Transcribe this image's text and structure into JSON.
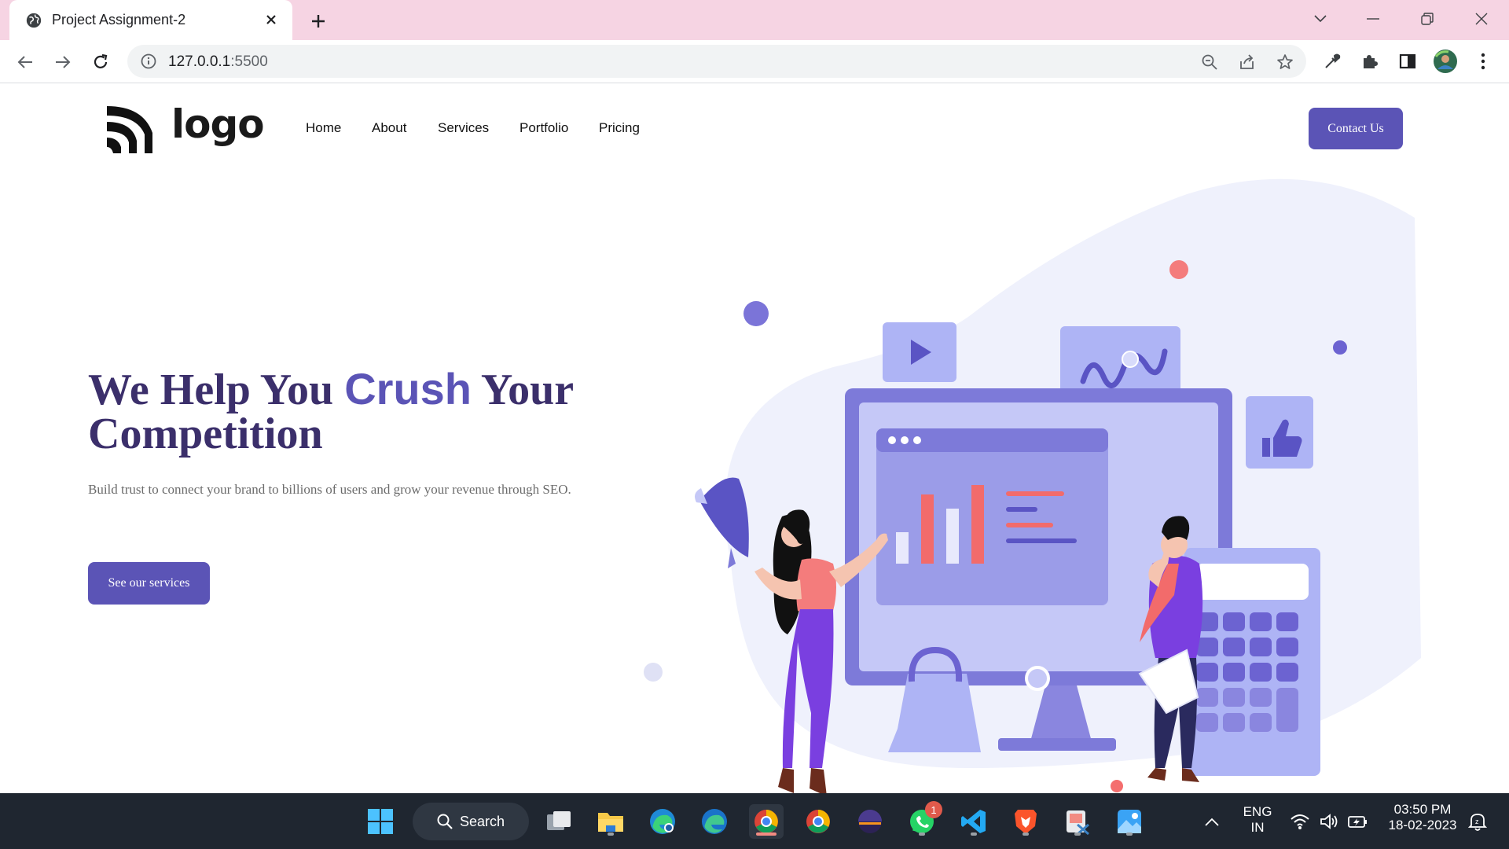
{
  "browser": {
    "tab_title": "Project Assignment-2",
    "url_host": "127.0.0.1",
    "url_port": ":5500"
  },
  "site": {
    "logo_text": "logo",
    "nav": [
      "Home",
      "About",
      "Services",
      "Portfolio",
      "Pricing"
    ],
    "contact_button": "Contact Us",
    "headline_part1": "We Help You ",
    "headline_accent": "Crush",
    "headline_part2": " Your Competition",
    "subtext": "Build trust to connect your brand to billions of users and grow your revenue through SEO.",
    "cta_button": "See our services"
  },
  "taskbar": {
    "search_label": "Search",
    "language_line1": "ENG",
    "language_line2": "IN",
    "time": "03:50 PM",
    "date": "18-02-2023",
    "whatsapp_badge": "1"
  },
  "colors": {
    "accent": "#5b54b6",
    "headline": "#3b2f6b",
    "tabbar": "#f6d4e3",
    "taskbar": "#1f2630"
  }
}
